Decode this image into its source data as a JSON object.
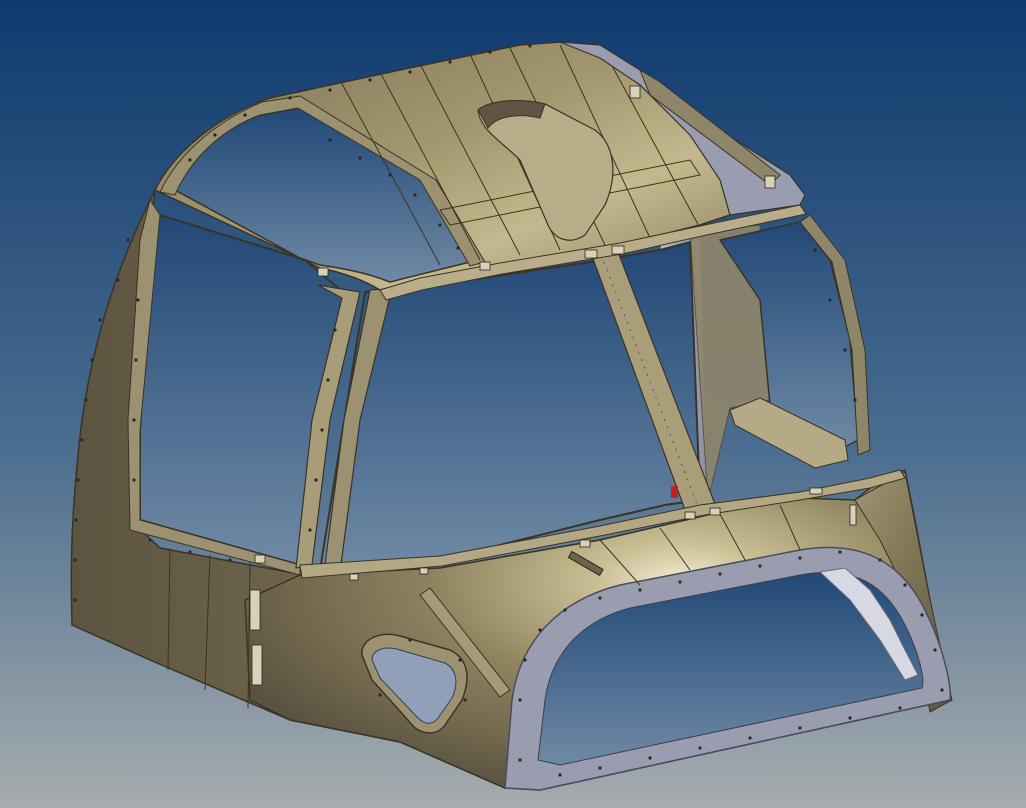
{
  "viewport": {
    "background_top_color": "#0f3a6e",
    "background_mid_color": "#4a6d8f",
    "background_bottom_color": "#a6acae"
  },
  "model": {
    "subject": "cockpit-canopy-frame",
    "skin_color": "#8a7f5c",
    "skin_highlight_color": "#e8e0c0",
    "skin_shadow_color": "#4e4634",
    "frame_color": "#9c9170",
    "inner_face_color": "#9a9cb0",
    "fastener_color": "#2a2820",
    "marker_color": "#c02020"
  }
}
